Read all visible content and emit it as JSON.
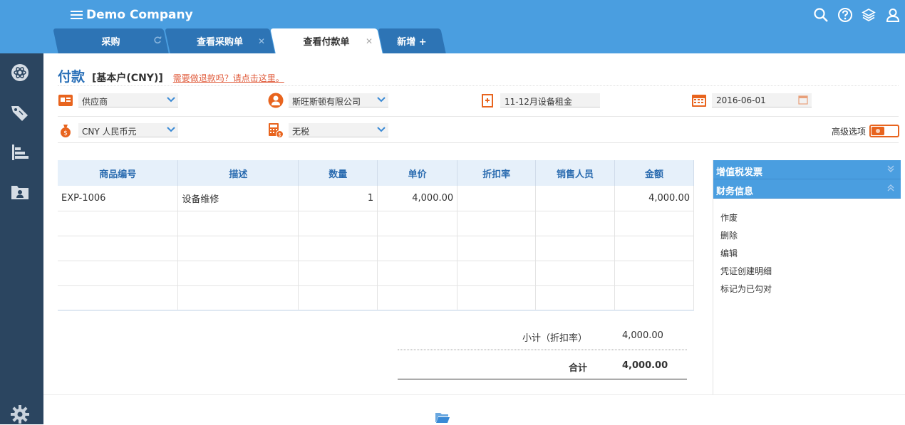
{
  "header": {
    "company": "Demo Company",
    "tabs": [
      {
        "label": "采购"
      },
      {
        "label": "查看采购单",
        "close": "✕"
      },
      {
        "label": "查看付款单",
        "close": "✕"
      },
      {
        "label": "新增 +"
      }
    ]
  },
  "page": {
    "title": "付款",
    "account": "[基本户(CNY)]",
    "refund_link": "需要做退款吗？请点击这里。"
  },
  "form": {
    "contact_type": "供应商",
    "contact_name": "斯旺斯顿有限公司",
    "reference": "11-12月设备租金",
    "date": "2016-06-01",
    "currency": "CNY 人民币元",
    "tax": "无税",
    "advanced_label": "高级选项"
  },
  "table": {
    "headers": [
      "商品编号",
      "描述",
      "数量",
      "单价",
      "折扣率",
      "销售人员",
      "金额"
    ],
    "rows": [
      [
        "EXP-1006",
        "设备维修",
        "1",
        "4,000.00",
        "",
        "",
        "4,000.00"
      ],
      [
        "",
        "",
        "",
        "",
        "",
        "",
        ""
      ],
      [
        "",
        "",
        "",
        "",
        "",
        "",
        ""
      ],
      [
        "",
        "",
        "",
        "",
        "",
        "",
        ""
      ],
      [
        "",
        "",
        "",
        "",
        "",
        "",
        ""
      ]
    ]
  },
  "summary": {
    "subtotal_label": "小计（折扣率）",
    "subtotal_value": "4,000.00",
    "total_label": "合计",
    "total_value": "4,000.00"
  },
  "panel": {
    "vat_title": "增值税发票",
    "finance_title": "财务信息",
    "actions": [
      "作废",
      "删除",
      "编辑",
      "凭证创建明细",
      "标记为已勾对"
    ]
  },
  "colors": {
    "topbar": "#4a9ee0",
    "sidebar": "#2b4560",
    "accent_orange": "#e8641e",
    "title_blue": "#2a70b8",
    "link_red": "#e05a3a"
  },
  "icons": {
    "sidebar": [
      "atom-icon",
      "tags-icon",
      "bar-chart-icon",
      "folder-user-icon",
      "gear-icon"
    ],
    "topbar": [
      "search-icon",
      "help-icon",
      "layers-icon",
      "user-icon"
    ]
  }
}
